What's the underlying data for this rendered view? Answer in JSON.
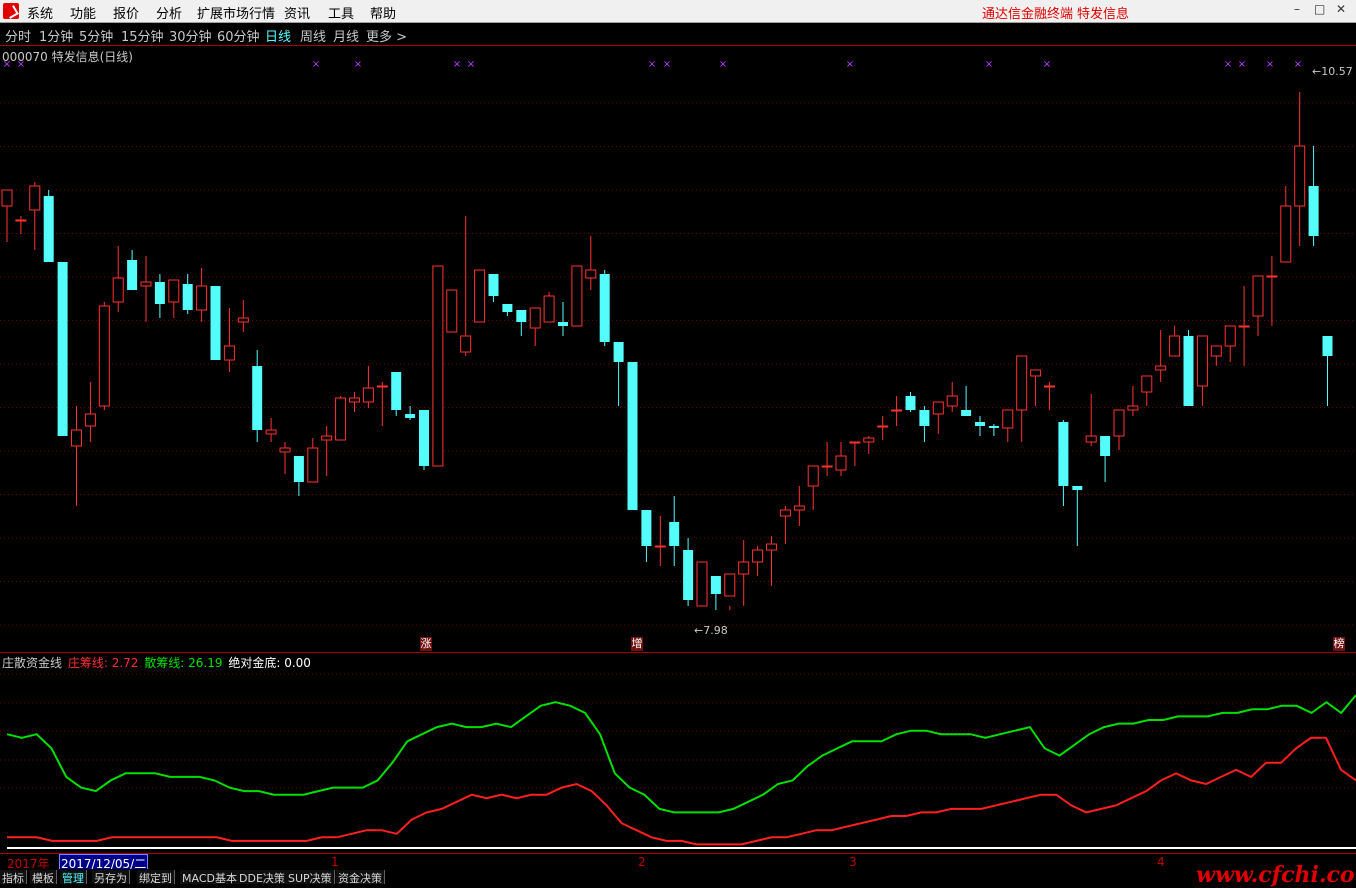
{
  "menu": {
    "items": [
      "系统",
      "功能",
      "报价",
      "分析",
      "扩展市场行情",
      "资讯",
      "工具",
      "帮助"
    ],
    "brand_left": "通达信金融终端",
    "brand_right": "特发信息"
  },
  "periods": [
    "分时",
    "1分钟",
    "5分钟",
    "15分钟",
    "30分钟",
    "60分钟",
    "日线",
    "周线",
    "月线",
    "更多 >"
  ],
  "active_period": "日线",
  "main_chart": {
    "title": "000070 特发信息(日线)",
    "high_label": "10.57",
    "low_label": "7.98",
    "markers": [
      "涨",
      "增",
      "榜"
    ]
  },
  "indicator": {
    "name": "庄散资金线",
    "zhuang_label": "庄筹线:",
    "zhuang_value": "2.72",
    "san_label": "散筹线:",
    "san_value": "26.19",
    "jd_label": "绝对金底:",
    "jd_value": "0.00"
  },
  "date_axis": {
    "year": "2017年",
    "cursor_date": "2017/12/05/二",
    "months": [
      "1",
      "2",
      "3",
      "4"
    ]
  },
  "bottom_tabs": [
    "指标",
    "模板",
    "管理",
    "另存为",
    "绑定到",
    "MACD基本",
    "DDE决策",
    "SUP决策",
    "资金决策"
  ],
  "active_tab": "管理",
  "watermark": "www.cfchi.com",
  "colors": {
    "up": "#ff3232",
    "down": "#54fcfc",
    "green_line": "#00e000",
    "red_line": "#ff2020",
    "grid": "#700000"
  },
  "chart_data": [
    {
      "type": "candlestick",
      "title": "000070 特发信息(日线)",
      "annotations": {
        "high": 10.57,
        "low": 7.98
      },
      "series": [
        {
          "name": "OHLC",
          "ohlc": [
            [
              10.0,
              10.08,
              9.82,
              10.08
            ],
            [
              9.93,
              9.95,
              9.86,
              9.93
            ],
            [
              9.98,
              10.12,
              9.78,
              10.1
            ],
            [
              10.05,
              10.08,
              9.72,
              9.72
            ],
            [
              9.72,
              9.72,
              8.85,
              8.85
            ],
            [
              8.8,
              9.0,
              8.5,
              8.88
            ],
            [
              8.9,
              9.12,
              8.82,
              8.96
            ],
            [
              9.0,
              9.52,
              8.98,
              9.5
            ],
            [
              9.52,
              9.8,
              9.47,
              9.64
            ],
            [
              9.73,
              9.78,
              9.58,
              9.58
            ],
            [
              9.6,
              9.75,
              9.42,
              9.62
            ],
            [
              9.62,
              9.66,
              9.44,
              9.51
            ],
            [
              9.52,
              9.63,
              9.44,
              9.63
            ],
            [
              9.61,
              9.66,
              9.46,
              9.48
            ],
            [
              9.48,
              9.69,
              9.42,
              9.6
            ],
            [
              9.6,
              9.6,
              9.25,
              9.23
            ],
            [
              9.23,
              9.49,
              9.17,
              9.3
            ],
            [
              9.42,
              9.53,
              9.37,
              9.44
            ],
            [
              9.2,
              9.28,
              8.82,
              8.88
            ],
            [
              8.86,
              8.94,
              8.82,
              8.88
            ],
            [
              8.77,
              8.82,
              8.66,
              8.79
            ],
            [
              8.75,
              8.75,
              8.55,
              8.62
            ],
            [
              8.62,
              8.84,
              8.62,
              8.79
            ],
            [
              8.83,
              8.9,
              8.65,
              8.85
            ],
            [
              8.83,
              9.05,
              8.83,
              9.04
            ],
            [
              9.02,
              9.07,
              8.97,
              9.04
            ],
            [
              9.02,
              9.2,
              8.99,
              9.09
            ],
            [
              9.1,
              9.12,
              8.9,
              9.1
            ],
            [
              9.17,
              9.17,
              8.95,
              8.98
            ],
            [
              8.96,
              9.0,
              8.93,
              8.94
            ],
            [
              8.98,
              8.98,
              8.68,
              8.7
            ],
            [
              8.7,
              9.7,
              8.7,
              9.7
            ],
            [
              9.37,
              9.55,
              9.37,
              9.58
            ],
            [
              9.27,
              9.95,
              9.25,
              9.35
            ],
            [
              9.42,
              9.65,
              9.42,
              9.68
            ],
            [
              9.66,
              9.55,
              9.52,
              9.55
            ],
            [
              9.51,
              9.47,
              9.45,
              9.47
            ],
            [
              9.48,
              9.42,
              9.35,
              9.42
            ],
            [
              9.39,
              9.47,
              9.3,
              9.49
            ],
            [
              9.42,
              9.57,
              9.42,
              9.55
            ],
            [
              9.42,
              9.52,
              9.35,
              9.4
            ],
            [
              9.4,
              9.7,
              9.4,
              9.7
            ],
            [
              9.64,
              9.85,
              9.58,
              9.68
            ],
            [
              9.66,
              9.68,
              9.3,
              9.32
            ],
            [
              9.32,
              9.22,
              9.0,
              9.22
            ],
            [
              9.22,
              9.22,
              9.0,
              8.48
            ],
            [
              8.48,
              8.3,
              8.22,
              8.3
            ],
            [
              8.3,
              8.45,
              8.2,
              8.3
            ],
            [
              8.42,
              8.55,
              8.2,
              8.3
            ],
            [
              8.28,
              8.34,
              8.0,
              8.03
            ],
            [
              8.0,
              8.18,
              8.0,
              8.22
            ],
            [
              8.15,
              8.14,
              7.98,
              8.06
            ],
            [
              8.05,
              8.0,
              7.98,
              8.16
            ],
            [
              8.16,
              8.33,
              8.0,
              8.22
            ],
            [
              8.22,
              8.3,
              8.15,
              8.28
            ],
            [
              8.28,
              8.35,
              8.1,
              8.31
            ],
            [
              8.45,
              8.5,
              8.31,
              8.48
            ],
            [
              8.48,
              8.6,
              8.4,
              8.5
            ],
            [
              8.6,
              8.68,
              8.48,
              8.7
            ],
            [
              8.7,
              8.82,
              8.65,
              8.7
            ],
            [
              8.68,
              8.82,
              8.65,
              8.75
            ],
            [
              8.82,
              8.82,
              8.7,
              8.82
            ],
            [
              8.82,
              8.85,
              8.76,
              8.84
            ],
            [
              8.9,
              8.95,
              8.83,
              8.9
            ],
            [
              8.98,
              9.05,
              8.9,
              8.98
            ],
            [
              9.05,
              9.07,
              8.97,
              8.98
            ],
            [
              8.98,
              9.0,
              8.82,
              8.9
            ],
            [
              8.96,
              8.98,
              8.86,
              9.02
            ],
            [
              9.0,
              9.12,
              8.97,
              9.05
            ],
            [
              8.98,
              9.1,
              8.96,
              8.95
            ],
            [
              8.92,
              8.95,
              8.85,
              8.9
            ],
            [
              8.9,
              8.91,
              8.85,
              8.89
            ],
            [
              8.89,
              8.95,
              8.82,
              8.98
            ],
            [
              8.98,
              9.25,
              8.82,
              9.25
            ],
            [
              9.15,
              9.18,
              9.0,
              9.18
            ],
            [
              9.1,
              9.12,
              8.98,
              9.1
            ],
            [
              8.92,
              8.93,
              8.5,
              8.6
            ],
            [
              8.6,
              8.6,
              8.3,
              8.58
            ],
            [
              8.82,
              9.06,
              8.8,
              8.85
            ],
            [
              8.85,
              8.85,
              8.62,
              8.75
            ],
            [
              8.85,
              8.93,
              8.78,
              8.98
            ],
            [
              8.98,
              9.1,
              8.95,
              9.0
            ],
            [
              9.07,
              9.13,
              9.0,
              9.15
            ],
            [
              9.18,
              9.38,
              9.12,
              9.2
            ],
            [
              9.25,
              9.4,
              9.25,
              9.35
            ],
            [
              9.35,
              9.38,
              9.0,
              9.0
            ],
            [
              9.1,
              9.2,
              9.0,
              9.35
            ],
            [
              9.25,
              9.3,
              9.2,
              9.3
            ],
            [
              9.3,
              9.35,
              9.22,
              9.4
            ],
            [
              9.4,
              9.6,
              9.2,
              9.4
            ],
            [
              9.45,
              9.6,
              9.35,
              9.65
            ],
            [
              9.65,
              9.75,
              9.4,
              9.65
            ],
            [
              9.72,
              10.1,
              9.72,
              10.0
            ],
            [
              10.0,
              10.57,
              9.8,
              10.3
            ],
            [
              10.1,
              10.3,
              9.8,
              9.85
            ],
            [
              9.35,
              9.25,
              9.0,
              9.25
            ]
          ]
        }
      ]
    },
    {
      "type": "line",
      "title": "庄散资金线",
      "series": [
        {
          "name": "散筹线",
          "values": [
            32,
            31,
            32,
            28,
            20,
            17,
            16,
            19,
            21,
            21,
            21,
            20,
            20,
            20,
            19,
            17,
            16,
            16,
            15,
            15,
            15,
            16,
            17,
            17,
            17,
            19,
            24,
            30,
            32,
            34,
            35,
            34,
            34,
            35,
            34,
            37,
            40,
            41,
            40,
            38,
            32,
            21,
            17,
            15,
            11,
            10,
            10,
            10,
            10,
            11,
            13,
            15,
            18,
            19,
            23,
            26,
            28,
            30,
            30,
            30,
            32,
            33,
            33,
            32,
            32,
            32,
            31,
            32,
            33,
            34,
            28,
            26,
            29,
            32,
            34,
            35,
            35,
            36,
            36,
            37,
            37,
            37,
            38,
            38,
            39,
            39,
            40,
            40,
            38,
            41,
            38,
            43
          ]
        },
        {
          "name": "庄筹线",
          "values": [
            3,
            3,
            3,
            2,
            2,
            2,
            2,
            3,
            3,
            3,
            3,
            3,
            3,
            3,
            3,
            2,
            2,
            2,
            2,
            2,
            2,
            3,
            3,
            4,
            5,
            5,
            4,
            8,
            10,
            11,
            13,
            15,
            14,
            15,
            14,
            15,
            15,
            17,
            18,
            16,
            12,
            7,
            5,
            3,
            2,
            2,
            1,
            1,
            1,
            1,
            2,
            3,
            3,
            4,
            5,
            5,
            6,
            7,
            8,
            9,
            9,
            10,
            10,
            11,
            11,
            11,
            12,
            13,
            14,
            15,
            15,
            12,
            10,
            11,
            12,
            14,
            16,
            19,
            21,
            19,
            18,
            20,
            22,
            20,
            24,
            24,
            28,
            31,
            31,
            22,
            19
          ]
        },
        {
          "name": "绝对金底",
          "values": [
            0,
            0,
            0,
            0,
            0,
            0,
            0,
            0,
            0,
            0,
            0,
            0,
            0,
            0,
            0,
            0,
            0,
            0,
            0,
            0,
            0,
            0,
            0,
            0,
            0,
            0,
            0,
            0,
            0,
            0,
            0,
            0,
            0,
            0,
            0,
            0,
            0,
            0,
            0,
            0,
            0,
            0,
            0,
            0,
            0,
            0,
            0,
            0,
            0,
            0,
            0,
            0,
            0,
            0,
            0,
            0,
            0,
            0,
            0,
            0,
            0,
            0,
            0,
            0,
            0,
            0,
            0,
            0,
            0,
            0,
            0,
            0,
            0,
            0,
            0,
            0,
            0,
            0,
            0,
            0,
            0,
            0,
            0,
            0,
            0,
            0,
            0,
            0,
            0,
            0,
            0,
            0,
            0
          ]
        }
      ]
    }
  ]
}
